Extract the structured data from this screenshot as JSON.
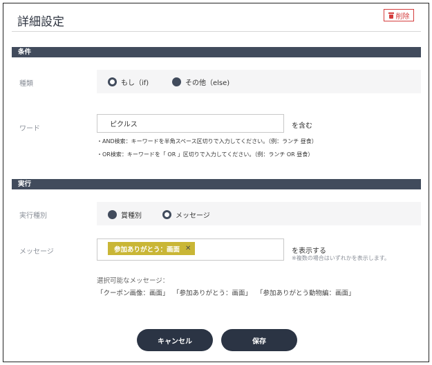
{
  "header": {
    "title": "詳細設定",
    "delete_label": "削除"
  },
  "condition": {
    "section_label": "条件",
    "type_label": "種類",
    "type_options": [
      {
        "label": "もし（if)",
        "selected": true
      },
      {
        "label": "その他（else)",
        "selected": false
      }
    ],
    "word_label": "ワード",
    "word_value": "ピクルス",
    "word_suffix": "を含む",
    "notes": [
      "・AND検索：キーワードを半角スペース区切りで入力してください。（例：ランチ 昼食）",
      "・OR検索：キーワードを「 OR 」区切りで入力してください。（例：ランチ OR 昼食）"
    ]
  },
  "action": {
    "section_label": "実行",
    "kind_label": "実行種別",
    "kind_options": [
      {
        "label": "賞種別",
        "selected": false
      },
      {
        "label": "メッセージ",
        "selected": true
      }
    ],
    "message_label": "メッセージ",
    "selected_tag": "参加ありがとう：画面",
    "tag_remove": "✕",
    "message_suffix": "を表示する",
    "message_note": "※複数の場合はいずれかを表示します。",
    "choices_title": "選択可能なメッセージ：",
    "choices": [
      "「クーポン画像：画面」",
      "「参加ありがとう：画面」",
      "「参加ありがとう動物編：画面」"
    ]
  },
  "footer": {
    "cancel_label": "キャンセル",
    "save_label": "保存"
  },
  "colors": {
    "accent": "#414b5c",
    "danger": "#d43c3c",
    "tag": "#c9b636",
    "button": "#2b3444"
  }
}
